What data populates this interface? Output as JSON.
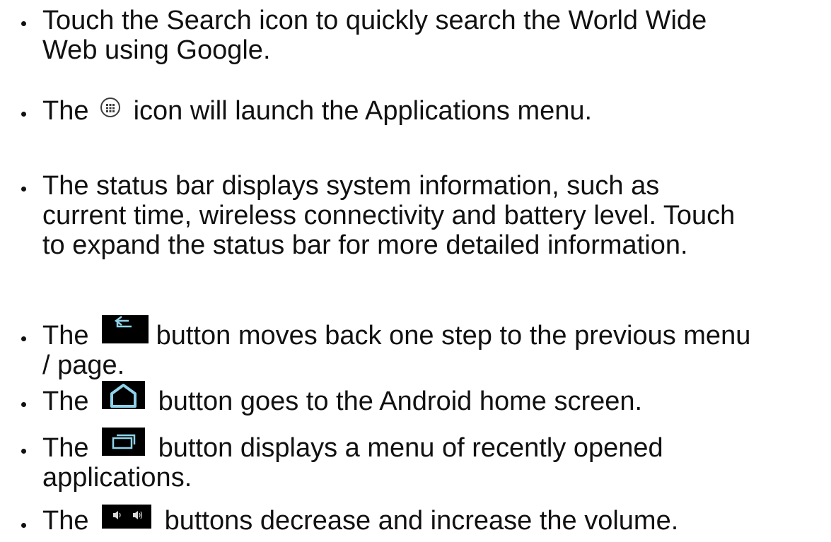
{
  "items": [
    {
      "lines": [
        "Touch the Search icon to quickly search the World Wide",
        "Web using Google."
      ]
    },
    {
      "before": "The",
      "icon": "apps-grid-icon",
      "after": "icon will launch the Applications menu."
    },
    {
      "lines": [
        "The status bar displays system information, such as",
        "current time, wireless connectivity and battery level. Touch",
        "to expand the status bar for more detailed information."
      ]
    },
    {
      "before": "The",
      "icon": "back-arrow-icon",
      "after": "button moves back one step to the previous menu",
      "line2": "/ page."
    },
    {
      "before": "The",
      "icon": "home-icon",
      "after": "button goes to the Android home screen."
    },
    {
      "before": "The",
      "icon": "recent-apps-icon",
      "after": "button displays a menu of recently opened",
      "line2": "applications."
    },
    {
      "before": "The",
      "icon": "volume-buttons-icon",
      "after": "buttons decrease and increase the volume."
    }
  ],
  "colors": {
    "text": "#111111",
    "icon_background": "#000000",
    "icon_glyph": "#8fd3ea"
  }
}
